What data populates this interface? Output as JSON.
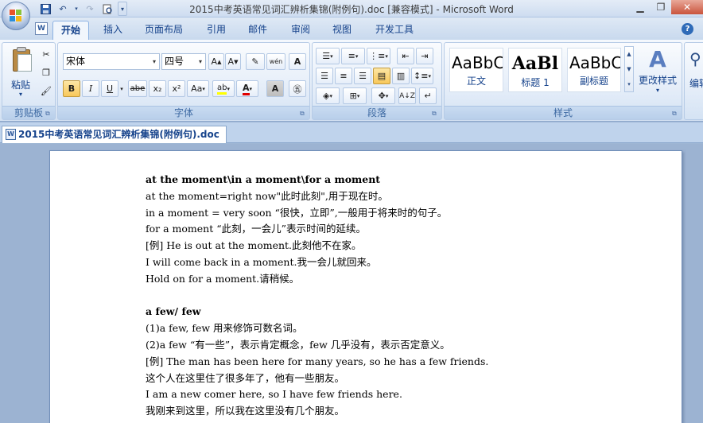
{
  "window": {
    "title": "2015中考英语常见词汇辨析集锦(附例句).doc [兼容模式] - Microsoft Word",
    "doc_tab": "2015中考英语常见词汇辨析集锦(附例句).doc"
  },
  "ribbon": {
    "tabs": [
      "开始",
      "插入",
      "页面布局",
      "引用",
      "邮件",
      "审阅",
      "视图",
      "开发工具"
    ],
    "active_tab": "开始",
    "groups": {
      "clipboard": {
        "label": "剪贴板",
        "paste_label": "粘贴"
      },
      "font": {
        "label": "字体",
        "font_name": "宋体",
        "font_size": "四号",
        "bold": "B",
        "italic": "I",
        "underline": "U",
        "strike": "abe",
        "sub": "x₂",
        "sup": "x²",
        "case": "Aa"
      },
      "paragraph": {
        "label": "段落"
      },
      "styles": {
        "label": "样式",
        "items": [
          {
            "sample": "AaBbC",
            "name": "正文"
          },
          {
            "sample": "AaBl",
            "name": "标题 1"
          },
          {
            "sample": "AaBbC",
            "name": "副标题"
          }
        ],
        "change_styles_label": "更改样式"
      },
      "editing": {
        "label": "编辑"
      }
    }
  },
  "document": {
    "lines": [
      {
        "text": "at the moment\\in a moment\\for a moment",
        "bold": true
      },
      {
        "text": "at the moment=right now\"此时此刻\",用于现在时。",
        "bold": false
      },
      {
        "text": "in a moment = very soon “很快，立即”,一般用于将来时的句子。",
        "bold": false
      },
      {
        "text": "for a moment “此刻，一会儿”表示时间的延续。",
        "bold": false
      },
      {
        "text": "[例] He is out at the moment.此刻他不在家。",
        "bold": false
      },
      {
        "text": "I will come back in a moment.我一会儿就回来。",
        "bold": false
      },
      {
        "text": "Hold on for a moment.请稍候。",
        "bold": false
      },
      {
        "text": "",
        "bold": false
      },
      {
        "text": "a few/ few",
        "bold": true
      },
      {
        "text": "(1)a few, few 用来修饰可数名词。",
        "bold": false
      },
      {
        "text": "(2)a few “有一些”，表示肯定概念，few 几乎没有，表示否定意义。",
        "bold": false
      },
      {
        "text": "[例] The man has been here for many years, so he has a few friends.",
        "bold": false
      },
      {
        "text": "这个人在这里住了很多年了，他有一些朋友。",
        "bold": false
      },
      {
        "text": "I am a new comer here, so I have few friends here.",
        "bold": false
      },
      {
        "text": "我刚来到这里，所以我在这里没有几个朋友。",
        "bold": false
      }
    ]
  }
}
